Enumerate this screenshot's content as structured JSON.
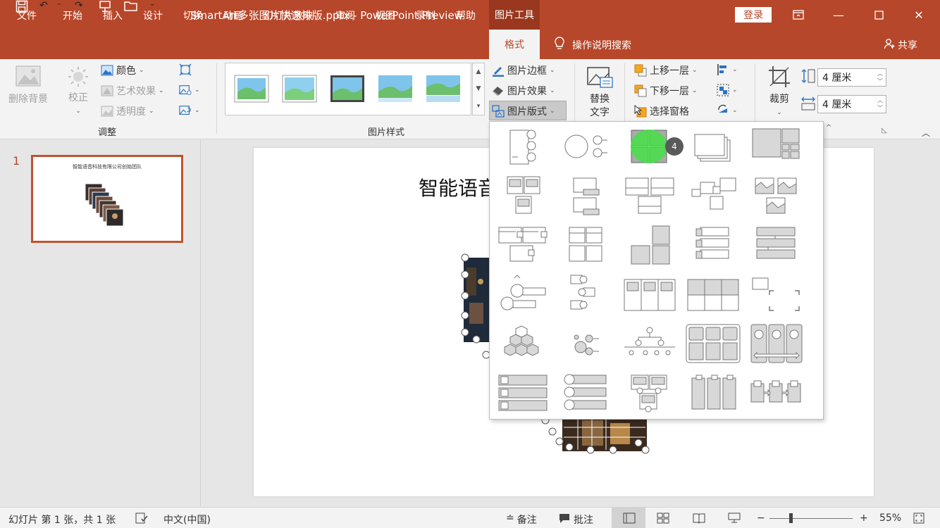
{
  "app": {
    "document_title": "SmartArt多张图片快速排版.pptx  -  PowerPoint Preview",
    "context_tab_group": "图片工具",
    "login_label": "登录"
  },
  "menu": {
    "items": [
      "文件",
      "开始",
      "插入",
      "设计",
      "切换",
      "动画",
      "幻灯片放映",
      "审阅",
      "视图",
      "录制",
      "帮助"
    ],
    "active_tab": "格式",
    "tell_me": "操作说明搜索",
    "share": "共享"
  },
  "ribbon": {
    "adjust": {
      "remove_bg": "删除背景",
      "corrections": "校正",
      "color": "颜色",
      "artistic": "艺术效果",
      "transparency": "透明度",
      "label": "调整"
    },
    "picture_styles": {
      "label": "图片样式",
      "border": "图片边框",
      "effects": "图片效果",
      "layout": "图片版式"
    },
    "accessibility": {
      "alt_text_line1": "替换",
      "alt_text_line2": "文字"
    },
    "arrange": {
      "bring_forward": "上移一层",
      "send_backward": "下移一层",
      "selection_pane": "选择窗格"
    },
    "size": {
      "crop": "裁剪",
      "height": "4 厘米",
      "width": "4 厘米"
    }
  },
  "slides": {
    "number": "1",
    "thumb_title": "智能语音科技有限公司创始团队"
  },
  "slide": {
    "title_visible": "智能语音"
  },
  "dropdown": {
    "badge": "4"
  },
  "status": {
    "slide_info": "幻灯片 第 1 张，共 1 张",
    "language": "中文(中国)",
    "notes": "备注",
    "comments": "批注",
    "zoom": "55%"
  },
  "colors": {
    "accent": "#b7472a",
    "accent_dark": "#99381f",
    "highlight": "#3ee63e"
  }
}
